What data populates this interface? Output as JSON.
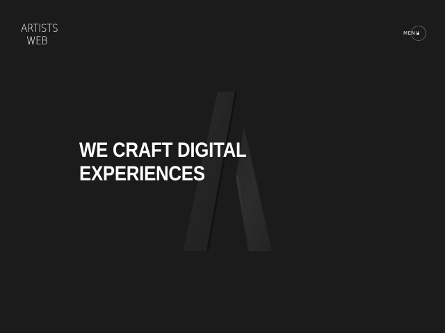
{
  "header": {
    "logo": {
      "line1": "ARTISTS",
      "line2": "WEB"
    },
    "menu": {
      "label": "MENU",
      "icon": "menu-dot-circle-icon"
    }
  },
  "hero": {
    "headline_line1": "WE CRAFT DIGITAL",
    "headline_line2": "EXPERIENCES",
    "graphic": "stylized-A-logo-mark"
  },
  "colors": {
    "background": "#1b1b1b",
    "text": "#ffffff",
    "accent_dark": "#2a2a2a"
  }
}
